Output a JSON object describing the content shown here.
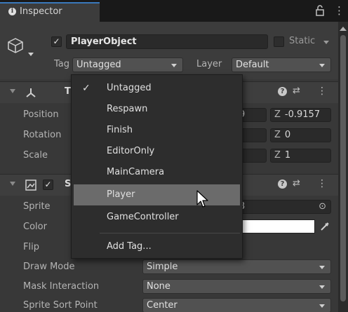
{
  "tab": {
    "icon": "info-icon",
    "title": "Inspector",
    "lock_icon": "lock-icon",
    "menu_icon": "kebab-menu-icon"
  },
  "header": {
    "object_icon": "cube-icon",
    "active_checked": true,
    "name": "PlayerObject",
    "static_label": "Static",
    "static_checked": false,
    "tag_label": "Tag",
    "tag_value": "Untagged",
    "layer_label": "Layer",
    "layer_value": "Default"
  },
  "transform": {
    "title_partial": "T",
    "icon": "transform-axes-icon",
    "position_label": "Position",
    "rotation_label": "Rotation",
    "scale_label": "Scale",
    "position_y_partial": "9",
    "position_z_axis": "Z",
    "position_z": "-0.9157",
    "rotation_z_axis": "Z",
    "rotation_z": "0",
    "scale_z_axis": "Z",
    "scale_z": "1"
  },
  "sprite_renderer": {
    "title_partial": "S",
    "icon": "sprite-renderer-icon",
    "enabled": true,
    "sprite_label": "Sprite",
    "sprite_value_partial": "3",
    "color_label": "Color",
    "color_value": "#ffffff",
    "flip_label": "Flip",
    "draw_mode_label": "Draw Mode",
    "draw_mode_value": "Simple",
    "mask_label": "Mask Interaction",
    "mask_value": "None",
    "sort_point_label": "Sprite Sort Point",
    "sort_point_value": "Center"
  },
  "tag_menu": {
    "items": [
      {
        "label": "Untagged",
        "checked": true
      },
      {
        "label": "Respawn"
      },
      {
        "label": "Finish"
      },
      {
        "label": "EditorOnly"
      },
      {
        "label": "MainCamera"
      },
      {
        "label": "Player",
        "highlighted": true
      },
      {
        "label": "GameController"
      }
    ],
    "add_tag_label": "Add Tag..."
  },
  "colors": {
    "background": "#383838",
    "accent": "#3a79bb",
    "highlight": "#6b6b6b",
    "menu_bg": "#2d2d2d"
  }
}
